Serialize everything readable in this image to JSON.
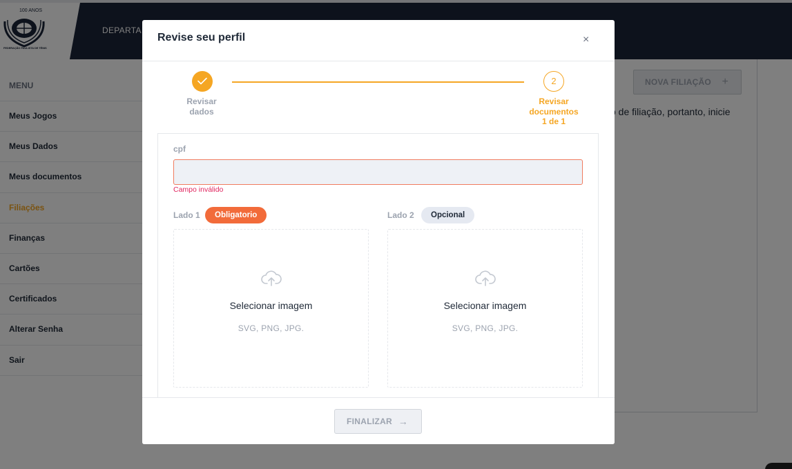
{
  "header": {
    "logo_years": "100 ANOS",
    "logo_org": "FEDERAÇÃO PAULISTA DE TÊNIS",
    "nav_partial": "DEPARTA"
  },
  "sidebar": {
    "title": "MENU",
    "items": [
      {
        "label": "Meus Jogos",
        "active": false
      },
      {
        "label": "Meus Dados",
        "active": false
      },
      {
        "label": "Meus documentos",
        "active": false
      },
      {
        "label": "Filiações",
        "active": true
      },
      {
        "label": "Finanças",
        "active": false
      },
      {
        "label": "Cartões",
        "active": false
      },
      {
        "label": "Certificados",
        "active": false
      },
      {
        "label": "Alterar Senha",
        "active": false
      },
      {
        "label": "Sair",
        "active": false
      }
    ]
  },
  "main": {
    "new_button": "NOVA FILIAÇÃO",
    "new_button_icon": "+",
    "text_partial": "o de filiação, portanto, inicie"
  },
  "modal": {
    "title": "Revise seu perfil",
    "close": "×",
    "steps": [
      {
        "label": "Revisar dados",
        "status": "done"
      },
      {
        "number": "2",
        "label_line1": "Revisar",
        "label_line2": "documentos",
        "label_line3": "1 de 1",
        "status": "current"
      }
    ],
    "form": {
      "cpf_label": "cpf",
      "cpf_value": "",
      "cpf_error": "Campo inválido",
      "side1_label": "Lado 1",
      "side1_badge": "Obligatorio",
      "side2_label": "Lado 2",
      "side2_badge": "Opcional",
      "dropzone_text": "Selecionar imagem",
      "dropzone_types": "SVG, PNG, JPG."
    },
    "finish_button": "FINALIZAR",
    "finish_icon": "→"
  },
  "colors": {
    "accent": "#f5a623",
    "navy": "#1b2538",
    "error": "#f07b5e",
    "required": "#f26b3a"
  }
}
